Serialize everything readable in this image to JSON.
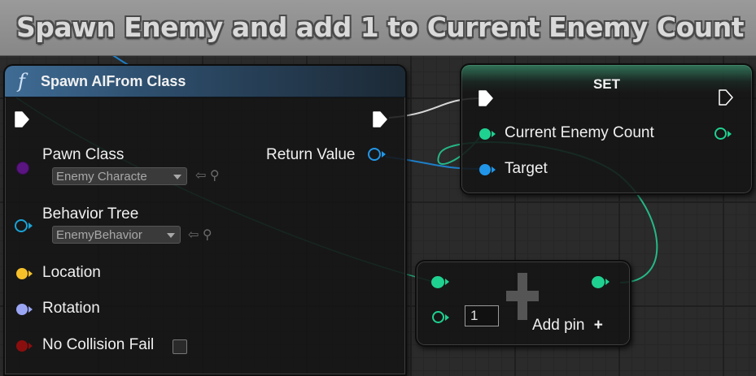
{
  "comment": {
    "title": "Spawn Enemy and add 1 to Current Enemy Count"
  },
  "spawn_node": {
    "title": "Spawn AIFrom Class",
    "func_icon": "f",
    "inputs": {
      "pawn_class": {
        "label": "Pawn Class",
        "value": "Enemy Characte"
      },
      "behavior_tree": {
        "label": "Behavior Tree",
        "value": "EnemyBehavior"
      },
      "location": {
        "label": "Location"
      },
      "rotation": {
        "label": "Rotation"
      },
      "no_collision_fail": {
        "label": "No Collision Fail"
      }
    },
    "outputs": {
      "return_value": {
        "label": "Return Value"
      }
    }
  },
  "set_node": {
    "title": "SET",
    "pins": {
      "current_enemy_count": "Current Enemy Count",
      "target": "Target"
    }
  },
  "add_node": {
    "value": "1",
    "add_pin_label": "Add pin",
    "add_pin_icon": "+"
  },
  "colors": {
    "object_pin": "#2196e8",
    "int_pin": "#1fd190",
    "struct_vector_pin": "#f6c02a",
    "rotator_pin": "#9aa6f4",
    "bool_pin": "#8b0e0e",
    "class_pin": "#5a1580",
    "exec_pin": "#ffffff",
    "wire_int": "#25b886",
    "wire_object": "#1e7fc8",
    "wire_exec": "#d8d8d8"
  }
}
